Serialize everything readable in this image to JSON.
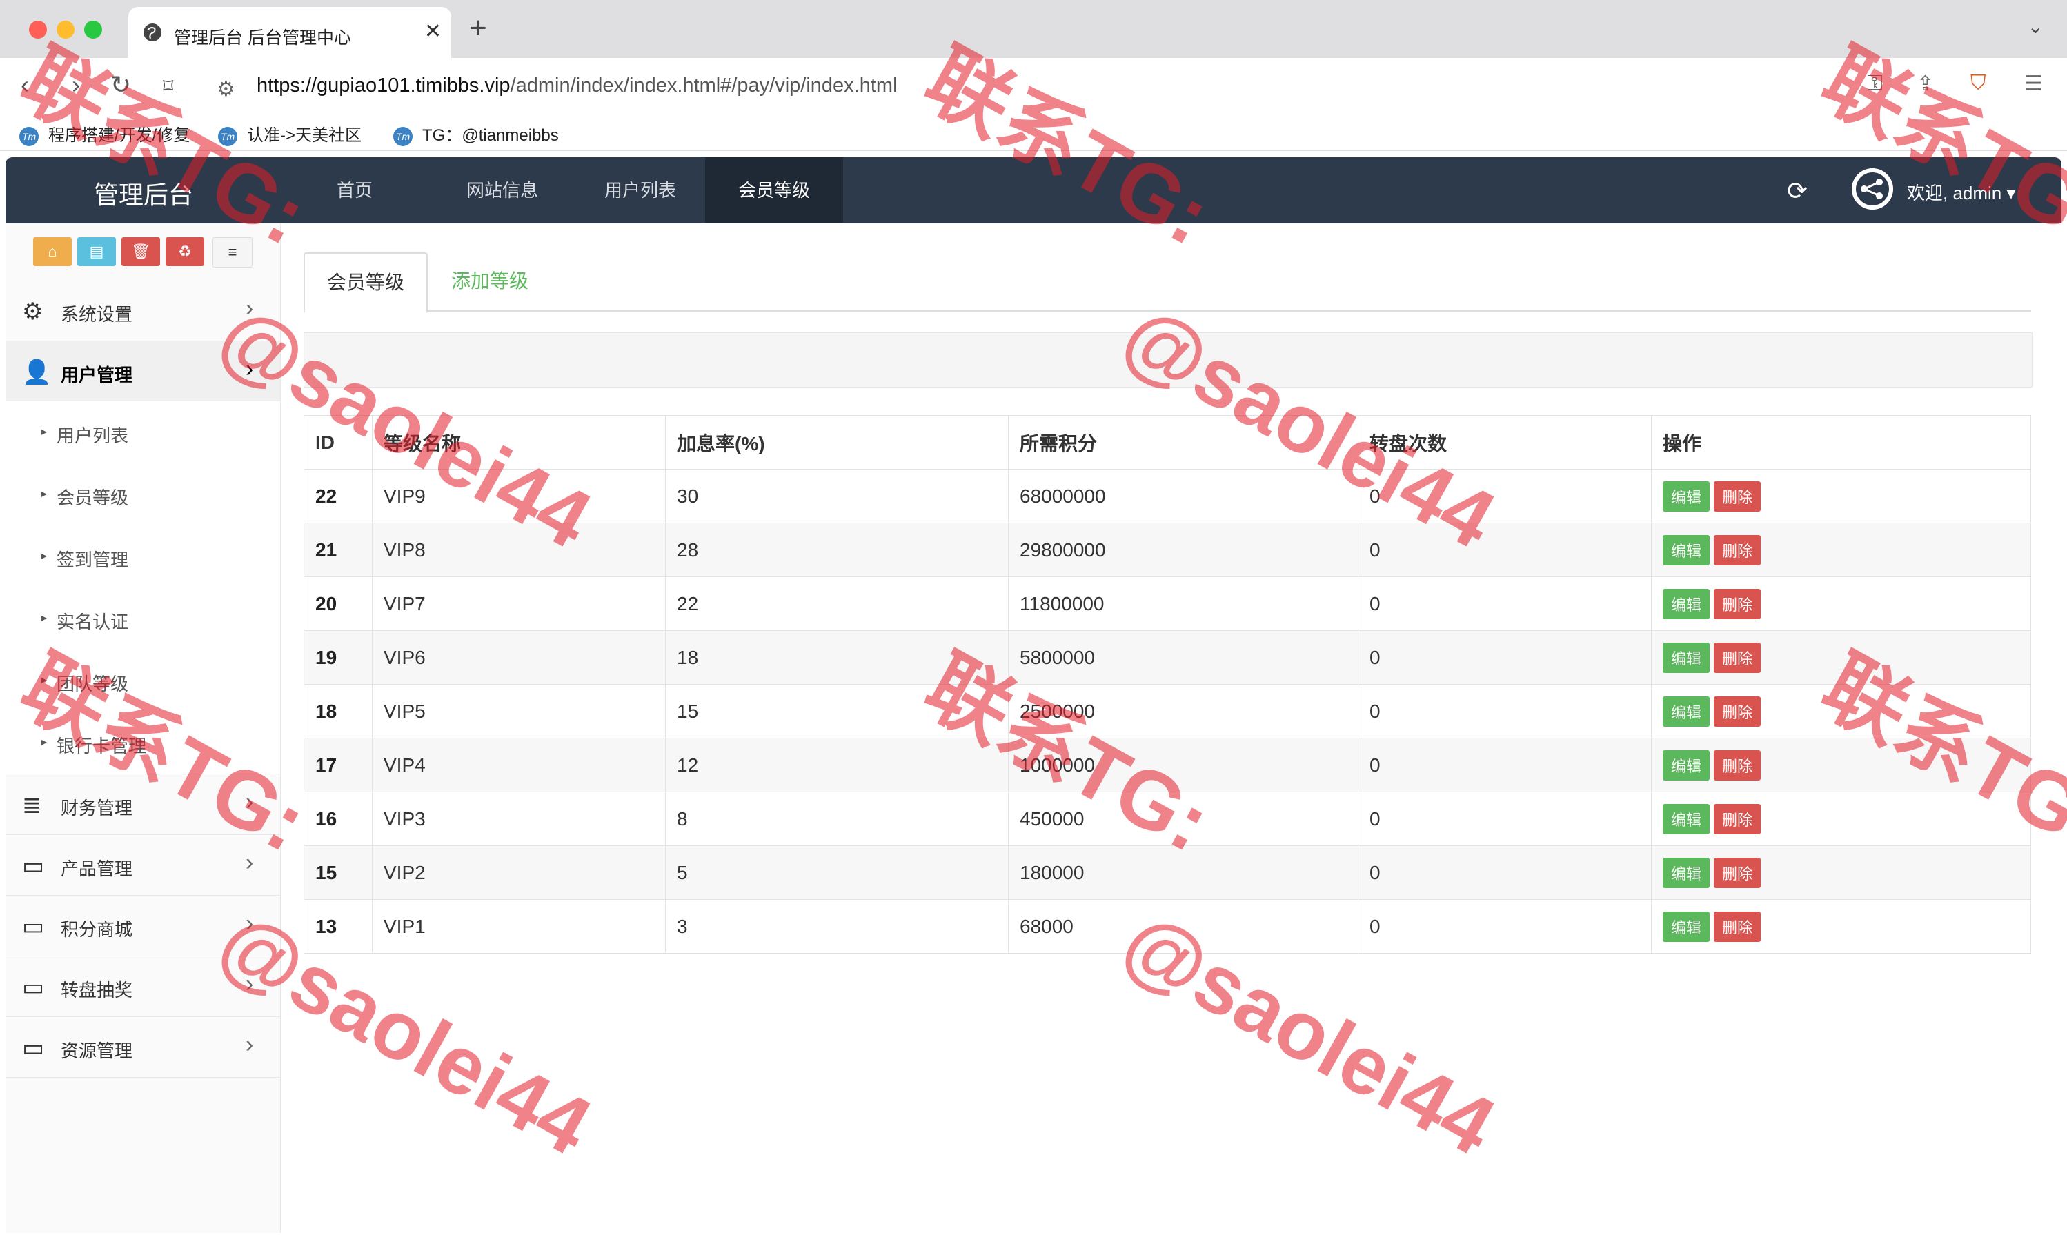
{
  "browser": {
    "tab_title": "管理后台 后台管理中心",
    "url_host": "https://gupiao101.timibbs.vip",
    "url_path": "/admin/index/index.html#/pay/vip/index.html",
    "bookmarks": [
      "程序搭建/开发/修复",
      "认准->天美社区",
      "TG：@tianmeibbs"
    ]
  },
  "app": {
    "brand": "管理后台",
    "nav": [
      "首页",
      "网站信息",
      "用户列表",
      "会员等级"
    ],
    "welcome": "欢迎, admin"
  },
  "sidebar": {
    "items": [
      {
        "label": "系统设置",
        "icon": "gears-icon"
      },
      {
        "label": "用户管理",
        "icon": "user-icon"
      }
    ],
    "sub_items": [
      "用户列表",
      "会员等级",
      "签到管理",
      "实名认证",
      "团队等级",
      "银行卡管理"
    ],
    "bottom_items": [
      {
        "label": "财务管理",
        "icon": "database-icon"
      },
      {
        "label": "产品管理",
        "icon": "monitor-icon"
      },
      {
        "label": "积分商城",
        "icon": "monitor-icon"
      },
      {
        "label": "转盘抽奖",
        "icon": "monitor-icon"
      },
      {
        "label": "资源管理",
        "icon": "monitor-icon"
      }
    ]
  },
  "page": {
    "tab_active": "会员等级",
    "tab_add": "添加等级"
  },
  "table": {
    "headers": [
      "ID",
      "等级名称",
      "加息率(%)",
      "所需积分",
      "转盘次数",
      "操作"
    ],
    "edit_label": "编辑",
    "delete_label": "删除",
    "rows": [
      [
        "22",
        "VIP9",
        "30",
        "68000000",
        "0"
      ],
      [
        "21",
        "VIP8",
        "28",
        "29800000",
        "0"
      ],
      [
        "20",
        "VIP7",
        "22",
        "11800000",
        "0"
      ],
      [
        "19",
        "VIP6",
        "18",
        "5800000",
        "0"
      ],
      [
        "18",
        "VIP5",
        "15",
        "2500000",
        "0"
      ],
      [
        "17",
        "VIP4",
        "12",
        "1000000",
        "0"
      ],
      [
        "16",
        "VIP3",
        "8",
        "450000",
        "0"
      ],
      [
        "15",
        "VIP2",
        "5",
        "180000",
        "0"
      ],
      [
        "13",
        "VIP1",
        "3",
        "68000",
        "0"
      ]
    ]
  },
  "watermark": {
    "line1": "联系TG:",
    "line2": "@saolei44"
  },
  "colors": {
    "nav_bg": "#2d3a4b",
    "edit_btn": "#5cb85c",
    "delete_btn": "#d9534f",
    "watermark": "#e11e28"
  }
}
